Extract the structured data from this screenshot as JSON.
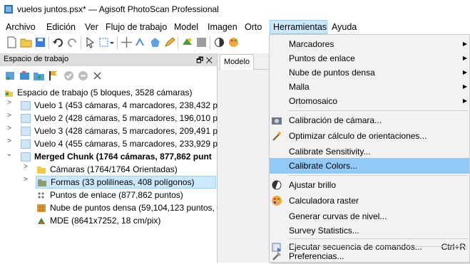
{
  "window": {
    "title": "vuelos juntos.psx* — Agisoft PhotoScan Professional"
  },
  "menubar": [
    "Archivo",
    "Edición",
    "Ver",
    "Flujo de trabajo",
    "Model",
    "Imagen",
    "Orto",
    "Herramientas",
    "Ayuda"
  ],
  "workspace": {
    "title": "Espacio de trabajo",
    "header_buttons": "🗗 ✕",
    "root": "Espacio de trabajo (5 bloques, 3528 cámaras)",
    "chunks": [
      "Vuelo 1 (453 cámaras, 4 marcadores, 238,432 pu",
      "Vuelo 2 (428 cámaras, 5 marcadores, 196,010 p",
      "Vuelo 3 (428 cámaras, 5 marcadores, 209,491 pu",
      "Vuelo 4 (455 cámaras, 5 marcadores, 233,929 pu"
    ],
    "merged": "Merged Chunk (1764 cámaras, 877,862 punt",
    "children": [
      "Cámaras (1764/1764 Orientadas)",
      "Formas (33 polilíneas, 408 polígonos)",
      "Puntos de enlace (877,862 puntos)",
      "Nube de puntos densa (59,104,123 puntos, C",
      "MDE (8641x7252, 18 cm/pix)"
    ]
  },
  "tabs": {
    "model": "Modelo"
  },
  "tools_menu": {
    "items": [
      {
        "label": "Marcadores",
        "submenu": true
      },
      {
        "label": "Puntos de enlace",
        "submenu": true
      },
      {
        "label": "Nube de puntos densa",
        "submenu": true
      },
      {
        "label": "Malla",
        "submenu": true
      },
      {
        "label": "Ortomosaico",
        "submenu": true
      },
      {
        "label": "Calibración de cámara...",
        "icon": "camera-icon"
      },
      {
        "label": "Optimizar cálculo de orientaciones...",
        "icon": "wand-icon"
      },
      {
        "label": "Calibrate Sensitivity..."
      },
      {
        "label": "Calibrate Colors...",
        "highlighted": true
      },
      {
        "label": "Ajustar brillo",
        "icon": "brightness-icon"
      },
      {
        "label": "Calculadora raster",
        "icon": "palette-icon"
      },
      {
        "label": "Generar curvas de nivel..."
      },
      {
        "label": "Survey Statistics..."
      },
      {
        "label": "Ejecutar secuencia de comandos...",
        "shortcut": "Ctrl+R",
        "icon": "script-icon"
      },
      {
        "label": "Preferencias...",
        "icon": "tools-icon"
      }
    ]
  },
  "colors": {
    "highlight": "#91c9f7",
    "menu_bg": "#f2f2f2",
    "selection": "#cce8ff"
  }
}
